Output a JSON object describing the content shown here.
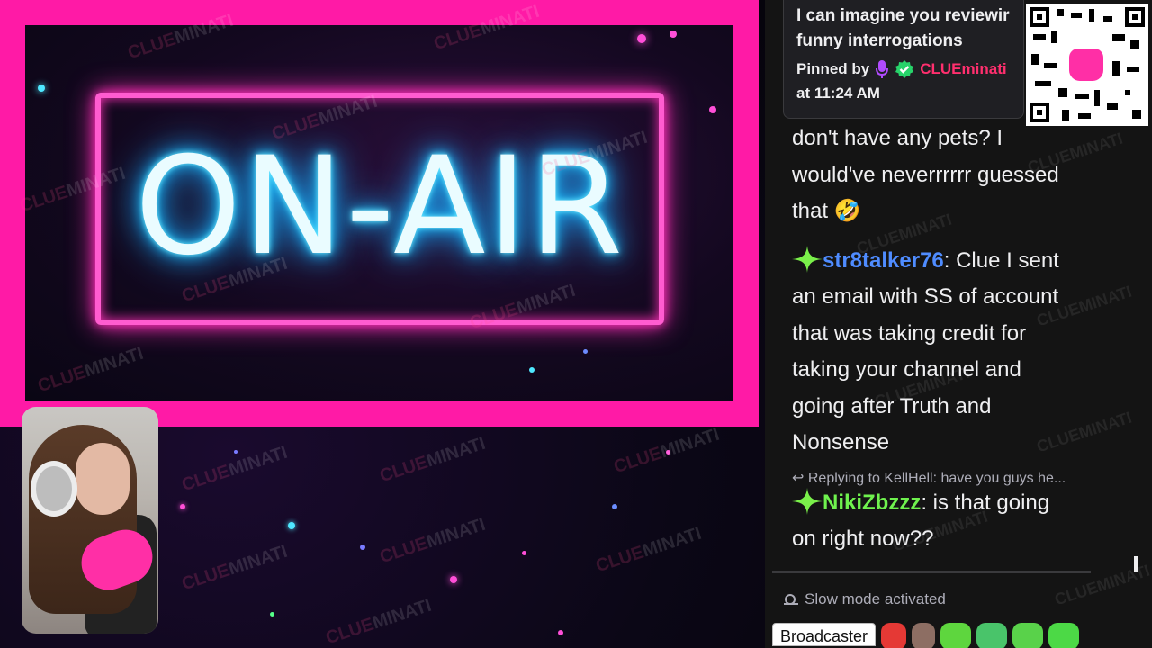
{
  "stream": {
    "sign_text": "ON-AIR",
    "watermark_text": "CLUEMINATI",
    "watermark_prefix": "CLUE",
    "watermark_suffix": "MINATI",
    "colors": {
      "frame": "#ff1aa6",
      "neon_text": "#22c9ff"
    }
  },
  "chat": {
    "pinned": {
      "message": "I can imagine you reviewing funny interrogations",
      "message_line1": "I can imagine you reviewir",
      "message_line2": "funny interrogations",
      "pinned_by_label": "Pinned by",
      "pinned_by_user": "CLUEminati",
      "time_label": "at 11:24 AM"
    },
    "messages": [
      {
        "user": "",
        "text_lines": [
          "don't have any pets? I",
          "would've neverrrrrr guessed",
          "that 🤣"
        ]
      },
      {
        "user": "str8talker76",
        "user_color": "#4f8cff",
        "text": ": Clue I sent",
        "text_lines": [
          "an email with SS of account",
          "that was taking credit for",
          "taking your channel and",
          "going after Truth and",
          "Nonsense"
        ]
      },
      {
        "reply": "Replying to KellHell: have you guys he...",
        "user": "NikiZbzzz",
        "user_color": "#6ff24e",
        "text": ": is that going",
        "text_lines": [
          "on right now??"
        ]
      }
    ],
    "slow_mode": "Slow mode activated",
    "badge_button": "Broadcaster"
  }
}
